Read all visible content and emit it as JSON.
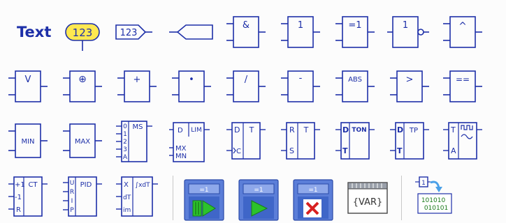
{
  "palette": {
    "text_tool": "Text",
    "variable_label": "123",
    "connector_label": "123",
    "and_gate": "&",
    "or_gate": "1",
    "xor_gate": "=1",
    "not_gate": "1",
    "caret_block": "^",
    "v_block": "V",
    "xor_circle_block": "⊕",
    "add_block": "+",
    "multiply_block": "•",
    "divide_block": "/",
    "subtract_block": "-",
    "abs_block": "ABS",
    "greater_block": ">",
    "equal_block": "==",
    "min_block": "MIN",
    "max_block": "MAX",
    "mux_label": "MS",
    "mux_inputs": [
      "0",
      "1",
      "2",
      "3",
      "A"
    ],
    "limit_label": "LIM",
    "limit_inputs": [
      "D",
      "MX",
      "MN"
    ],
    "flipflop_d": {
      "in1": "D",
      "in2": "C",
      "out": "T"
    },
    "flipflop_rs": {
      "in1": "R",
      "in2": "S",
      "out": "T"
    },
    "timer_ton": {
      "in1": "D",
      "in2": "T",
      "label": "TON"
    },
    "timer_tp": {
      "in1": "D",
      "in2": "T",
      "label": "TP"
    },
    "sampler": {
      "in1": "T",
      "in2": "A"
    },
    "counter": {
      "label": "CT",
      "inputs": [
        "+1",
        "-1",
        "R"
      ]
    },
    "pid": {
      "label": "PID",
      "inputs": [
        "U",
        "R",
        "I",
        "P"
      ]
    },
    "integrator": {
      "label": "∫xdT",
      "inputs": [
        "X",
        "dT",
        "im"
      ]
    },
    "var_block": "{VAR}",
    "binary_lines": [
      "101010",
      "010101"
    ],
    "frame_label": "=1",
    "colors": {
      "blue": "#1d2fa8",
      "yellow": "#ffe850",
      "green": "#2cc22c",
      "red": "#d82020"
    }
  }
}
